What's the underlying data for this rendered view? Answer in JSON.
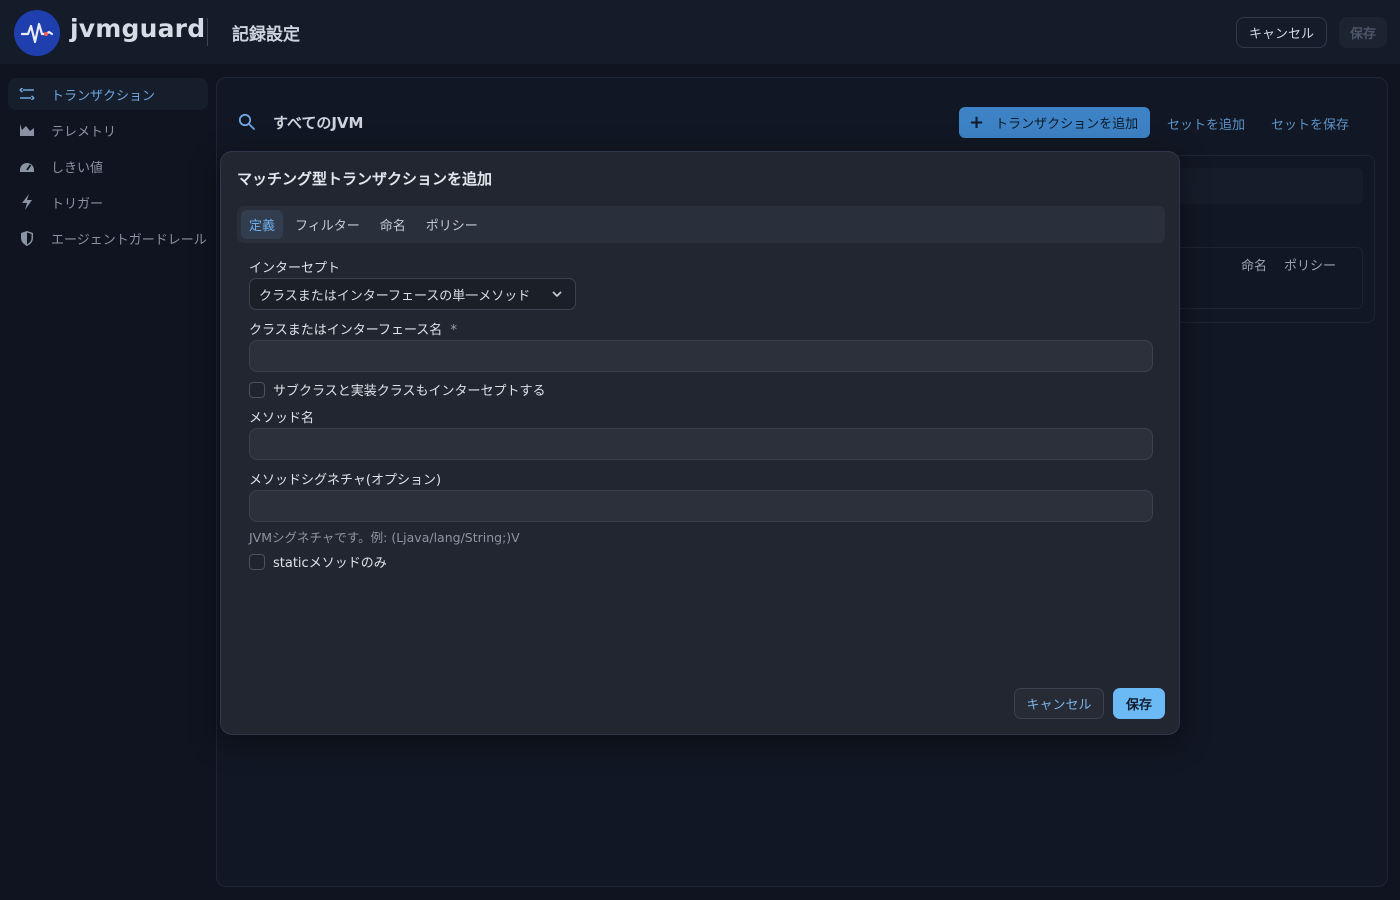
{
  "header": {
    "brand": "jvmguard",
    "title": "記録設定",
    "cancel_label": "キャンセル",
    "save_label": "保存"
  },
  "sidebar": {
    "items": [
      {
        "label": "トランザクション",
        "icon": "transactions-icon",
        "active": true
      },
      {
        "label": "テレメトリ",
        "icon": "chart-icon",
        "active": false
      },
      {
        "label": "しきい値",
        "icon": "gauge-icon",
        "active": false
      },
      {
        "label": "トリガー",
        "icon": "lightning-icon",
        "active": false
      },
      {
        "label": "エージェントガードレール",
        "icon": "shield-icon",
        "active": false
      }
    ]
  },
  "main": {
    "scope": "すべてのJVM",
    "add_transaction_label": "トランザクションを追加",
    "add_set_label": "セットを追加",
    "save_set_label": "セットを保存",
    "table_columns": [
      "命名",
      "ポリシー"
    ]
  },
  "modal": {
    "title": "マッチング型トランザクションを追加",
    "tabs": [
      {
        "label": "定義",
        "active": true
      },
      {
        "label": "フィルター",
        "active": false
      },
      {
        "label": "命名",
        "active": false
      },
      {
        "label": "ポリシー",
        "active": false
      }
    ],
    "intercept_label": "インターセプト",
    "intercept_value": "クラスまたはインターフェースの単一メソッド",
    "class_name_label": "クラスまたはインターフェース名",
    "required_mark": "*",
    "class_name_value": "",
    "subclass_check_label": "サブクラスと実装クラスもインターセプトする",
    "method_name_label": "メソッド名",
    "method_name_value": "",
    "signature_label": "メソッドシグネチャ(オプション)",
    "signature_value": "",
    "signature_hint": "JVMシグネチャです。例: (Ljava/lang/String;)V",
    "static_check_label": "staticメソッドのみ",
    "cancel_label": "キャンセル",
    "save_label": "保存"
  },
  "colors": {
    "accent": "#3d82c4",
    "primary_button": "#6bb9f5",
    "active_tab_text": "#6fb0ea",
    "background": "#0f1420"
  }
}
